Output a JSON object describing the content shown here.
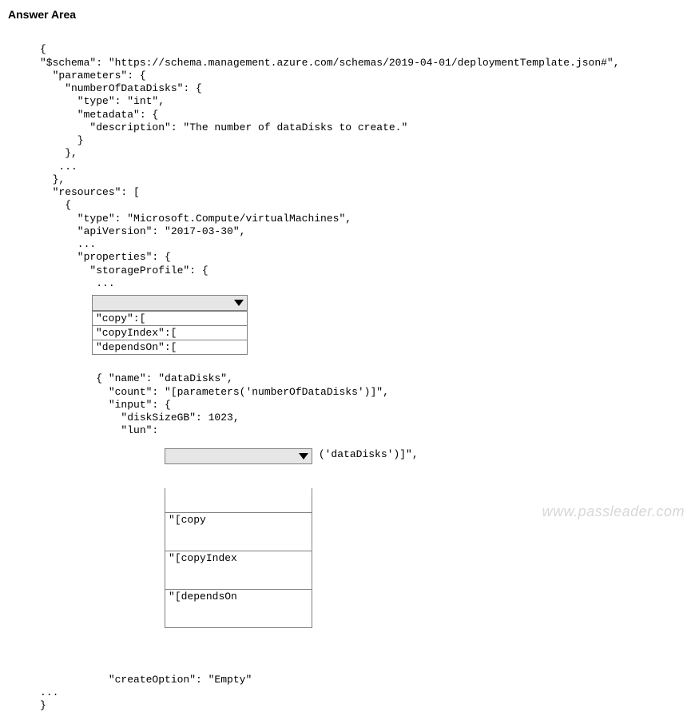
{
  "title": "Answer Area",
  "code": {
    "l01": "{",
    "l02": "\"$schema\": \"https://schema.management.azure.com/schemas/2019-04-01/deploymentTemplate.json#\",",
    "l03": "  \"parameters\": {",
    "l04": "    \"numberOfDataDisks\": {",
    "l05": "      \"type\": \"int\",",
    "l06": "      \"metadata\": {",
    "l07": "        \"description\": \"The number of dataDisks to create.\"",
    "l08": "      }",
    "l09": "    },",
    "l10": "   ...",
    "l11": "  },",
    "l12": "  \"resources\": [",
    "l13": "    {",
    "l14": "      \"type\": \"Microsoft.Compute/virtualMachines\",",
    "l15": "      \"apiVersion\": \"2017-03-30\",",
    "l16": "      ...",
    "l17": "      \"properties\": {",
    "l18": "        \"storageProfile\": {",
    "l19": "         ...",
    "l20": "         { \"name\": \"dataDisks\",",
    "l21": "           \"count\": \"[parameters('numberOfDataDisks')]\",",
    "l22": "           \"input\": {",
    "l23": "             \"diskSizeGB\": 1023,",
    "lun_prefix": "             \"lun\": ",
    "lun_suffix": " ('dataDisks')]\",",
    "l25": "           \"createOption\": \"Empty\"",
    "l26": "...",
    "l27": "}"
  },
  "dropdown1": {
    "opt0": "\"copy\":[",
    "opt1": "\"copyIndex\":[",
    "opt2": "\"dependsOn\":["
  },
  "dropdown2": {
    "opt0": "\"[copy",
    "opt1": "\"[copyIndex",
    "opt2": "\"[dependsOn"
  },
  "watermark": "www.passleader.com"
}
